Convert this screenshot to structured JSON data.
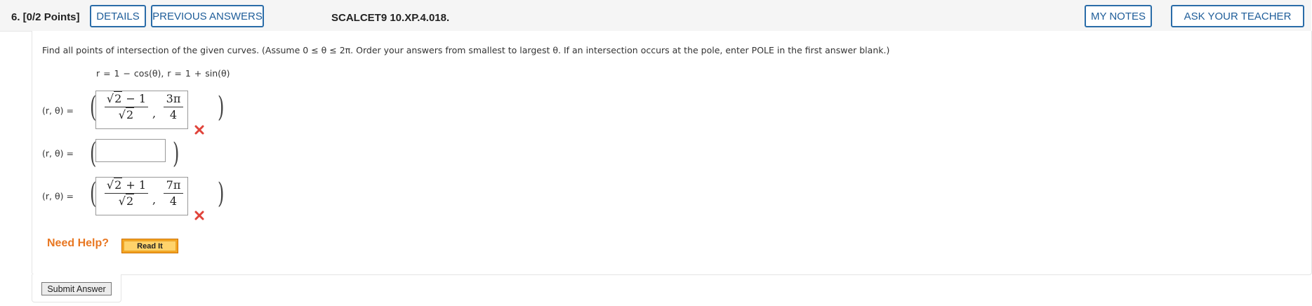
{
  "header": {
    "question_label": "6. [0/2 Points]",
    "details_button": "DETAILS",
    "previous_answers_button": "PREVIOUS ANSWERS",
    "question_id": "SCALCET9 10.XP.4.018.",
    "my_notes_button": "MY NOTES",
    "ask_teacher_button": "ASK YOUR TEACHER"
  },
  "question": {
    "prompt": "Find all points of intersection of the given curves. (Assume 0 ≤ θ ≤ 2π. Order your answers from smallest to largest θ. If an intersection occurs at the pole, enter POLE in the first answer blank.)",
    "curves": "r = 1 − cos(θ),    r = 1 + sin(θ)"
  },
  "answers": [
    {
      "label": "(r, θ) =",
      "r_numerator_radicand": "2",
      "r_numerator_rest": " − 1",
      "r_denominator_radicand": "2",
      "theta_numerator": "3π",
      "theta_denominator": "4",
      "status": "incorrect"
    },
    {
      "label": "(r, θ) =",
      "value": "",
      "status": "blank"
    },
    {
      "label": "(r, θ) =",
      "r_numerator_radicand": "2",
      "r_numerator_rest": " + 1",
      "r_denominator_radicand": "2",
      "theta_numerator": "7π",
      "theta_denominator": "4",
      "status": "incorrect"
    }
  ],
  "help": {
    "label": "Need Help?",
    "read_it_button": "Read It"
  },
  "submit_button": "Submit Answer",
  "icons": {
    "incorrect": "x-mark-icon"
  },
  "colors": {
    "button_border": "#2a6ca8",
    "button_text": "#1e5d99",
    "help_text": "#e87722",
    "read_it": "#f5a623",
    "incorrect_mark": "#e0433a"
  }
}
